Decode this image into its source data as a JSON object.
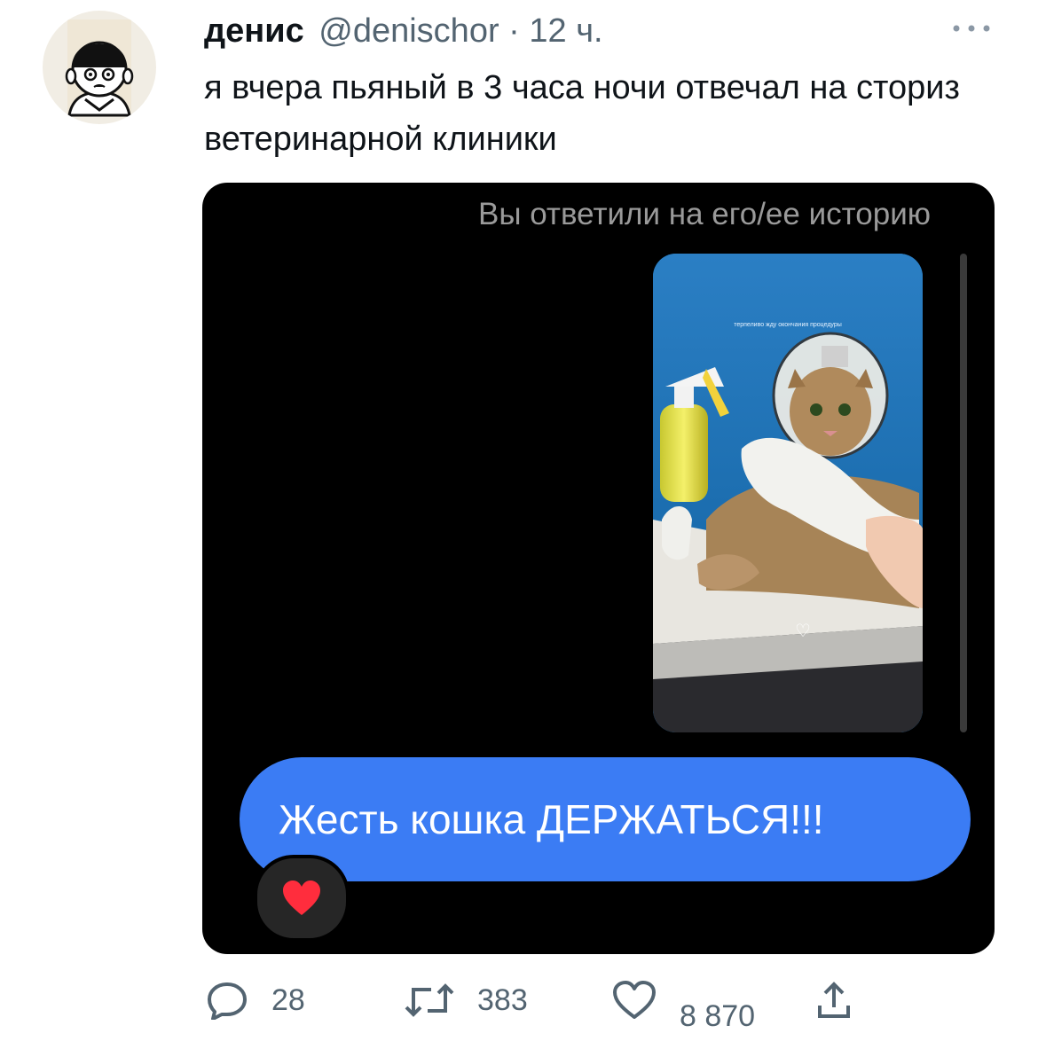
{
  "tweet": {
    "author_name": "денис",
    "author_handle": "@denischor",
    "separator": " · ",
    "timestamp": "12 ч.",
    "text": "я вчера пьяный в 3 часа ночи отвечал на сториз ветеринарной клиники"
  },
  "media": {
    "reply_note": "Вы ответили на его/ее историю",
    "story_caption": "терпеливо жду окончания процедуры",
    "message": "Жесть кошка ДЕРЖАТЬСЯ!!!",
    "reaction_icon": "heart-icon"
  },
  "actions": {
    "replies": "28",
    "retweets": "383",
    "likes": "8 870"
  },
  "colors": {
    "bubble": "#3b7cf4",
    "media_bg": "#000000",
    "meta_text": "#536471"
  }
}
